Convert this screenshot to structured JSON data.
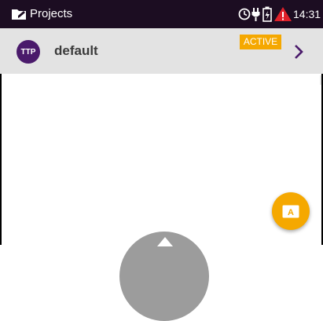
{
  "statusbar": {
    "title": "Projects",
    "time": "14:31",
    "icons": [
      "timer-icon",
      "power-plug-icon",
      "battery-charging-icon",
      "warning-icon"
    ],
    "background": "#1c0d22",
    "warning_color": "#e0202a"
  },
  "project": {
    "avatar": "TTP",
    "name": "default",
    "badge": "ACTIVE",
    "avatar_color": "#4a1a6b",
    "accent": "#f5a800",
    "chevron_color": "#4a1a6b"
  },
  "fab": {
    "icon": "keyboard-a-icon",
    "label": "A",
    "color": "#f5a800"
  },
  "nav": {
    "icon": "arrow-up-icon",
    "color": "#9c9c9c"
  }
}
